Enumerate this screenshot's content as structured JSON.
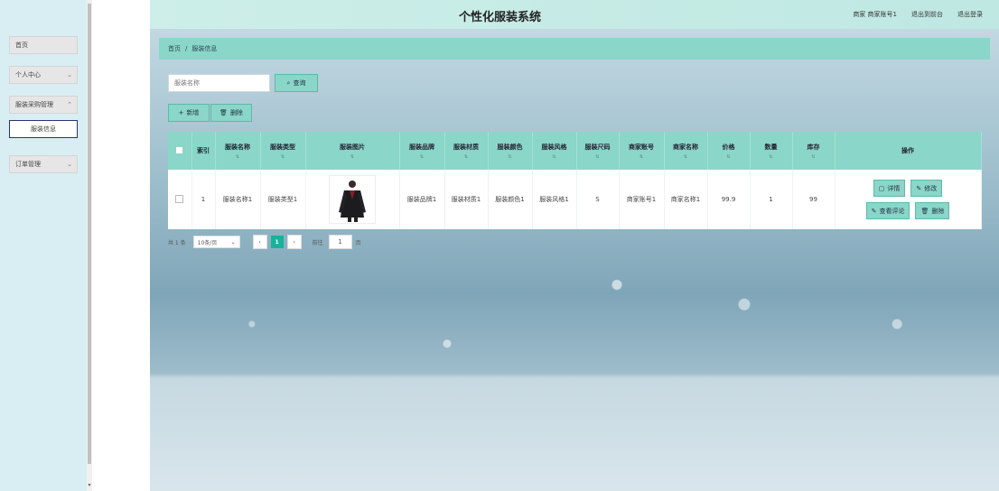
{
  "sidebar": {
    "items": [
      {
        "label": "首页"
      },
      {
        "label": "个人中心"
      },
      {
        "label": "服装采购管理"
      },
      {
        "label": "服装信息"
      },
      {
        "label": "订单管理"
      }
    ]
  },
  "header": {
    "title": "个性化服装系统",
    "user_text": "商家 商家账号1",
    "back_link": "退出到前台",
    "logout_link": "退出登录"
  },
  "breadcrumb": {
    "home": "首页",
    "separator": "/",
    "current": "服装信息"
  },
  "search": {
    "placeholder": "服装名称",
    "button_label": "查询"
  },
  "toolbar": {
    "add_label": "新增",
    "delete_label": "删除"
  },
  "table": {
    "columns": [
      "索引",
      "服装名称",
      "服装类型",
      "服装图片",
      "服装品牌",
      "服装材质",
      "服装颜色",
      "服装风格",
      "服装尺码",
      "商家账号",
      "商家名称",
      "价格",
      "数量",
      "库存",
      "操作"
    ],
    "rows": [
      {
        "index": "1",
        "name": "服装名称1",
        "type": "服装类型1",
        "brand": "服装品牌1",
        "material": "服装材质1",
        "color": "服装颜色1",
        "style": "服装风格1",
        "size": "S",
        "merchant_account": "商家账号1",
        "merchant_name": "商家名称1",
        "price": "99.9",
        "quantity": "1",
        "stock": "99"
      }
    ],
    "actions": {
      "detail": "详情",
      "edit": "修改",
      "review": "查看评论",
      "delete": "删除"
    }
  },
  "pagination": {
    "total": "共 1 条",
    "page_size": "10条/页",
    "current_page": "1",
    "goto_label": "前往",
    "goto_value": "1",
    "page_unit": "页"
  },
  "colors": {
    "accent": "#8ad6c8",
    "accent_dark": "#17b39b",
    "sidebar_bg": "#d9eef3",
    "topbar": "#cdeee9"
  }
}
